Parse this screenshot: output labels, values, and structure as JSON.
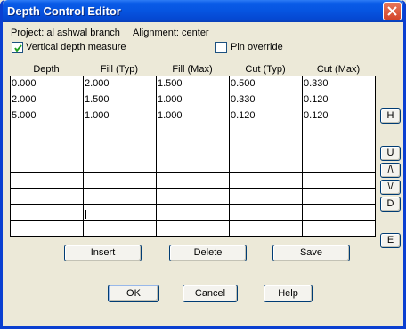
{
  "window": {
    "title": "Depth Control Editor"
  },
  "info": {
    "project": "Project: al ashwal branch",
    "alignment": "Alignment: center"
  },
  "options": {
    "vertical_depth_label": "Vertical depth measure",
    "vertical_depth_checked": true,
    "pin_override_label": "Pin override",
    "pin_override_checked": false
  },
  "table": {
    "headers": [
      "Depth",
      "Fill (Typ)",
      "Fill (Max)",
      "Cut (Typ)",
      "Cut (Max)"
    ],
    "rows": [
      [
        "0.000",
        "2.000",
        "1.500",
        "0.500",
        "0.330"
      ],
      [
        "2.000",
        "1.500",
        "1.000",
        "0.330",
        "0.120"
      ],
      [
        "5.000",
        "1.000",
        "1.000",
        "0.120",
        "0.120"
      ],
      [
        "",
        "",
        "",
        "",
        ""
      ],
      [
        "",
        "",
        "",
        "",
        ""
      ],
      [
        "",
        "",
        "",
        "",
        ""
      ],
      [
        "",
        "",
        "",
        "",
        ""
      ],
      [
        "",
        "",
        "",
        "",
        ""
      ],
      [
        "",
        "",
        "",
        "",
        ""
      ],
      [
        "",
        "",
        "",
        "",
        ""
      ]
    ]
  },
  "side_buttons": [
    "H",
    "U",
    "/\\",
    "\\/",
    "D",
    "E"
  ],
  "row_buttons": {
    "insert": "Insert",
    "delete": "Delete",
    "save": "Save"
  },
  "dialog_buttons": {
    "ok": "OK",
    "cancel": "Cancel",
    "help": "Help"
  }
}
